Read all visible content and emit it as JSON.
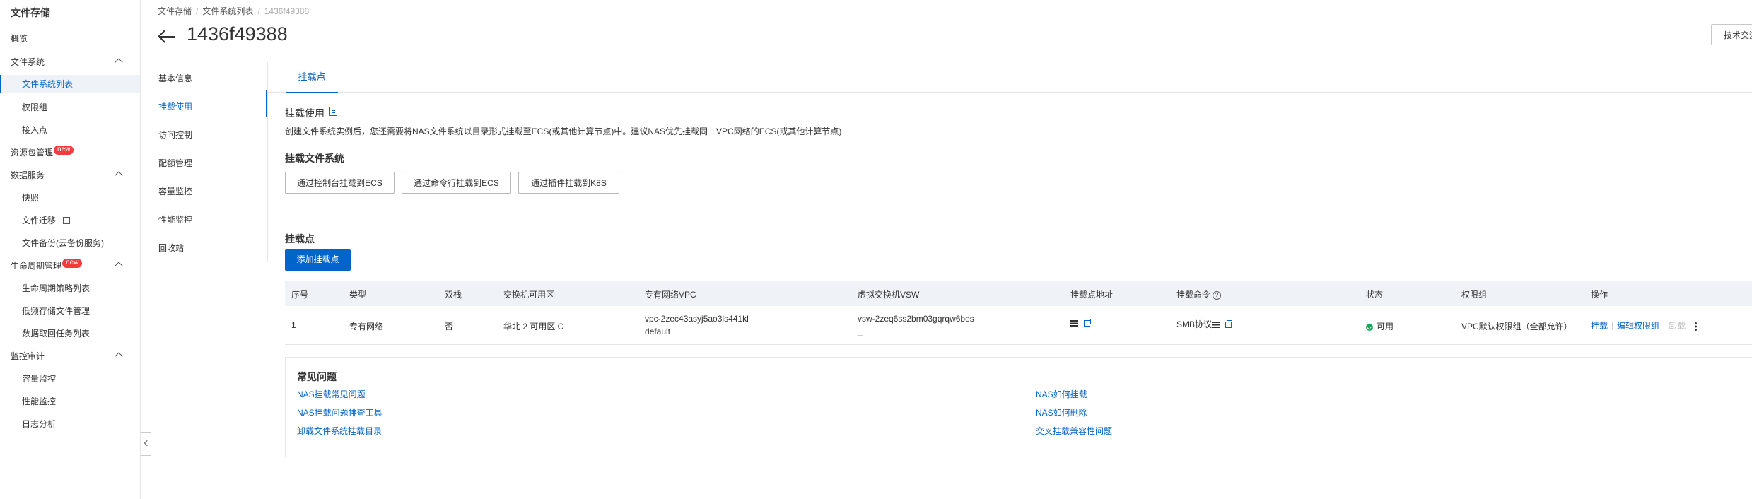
{
  "sidebar": {
    "title": "文件存储",
    "items": [
      {
        "label": "概览"
      },
      {
        "label": "文件系统"
      },
      {
        "label": "文件系统列表"
      },
      {
        "label": "权限组"
      },
      {
        "label": "接入点"
      },
      {
        "label": "资源包管理",
        "badge": "new"
      },
      {
        "label": "数据服务"
      },
      {
        "label": "快照"
      },
      {
        "label": "文件迁移"
      },
      {
        "label": "文件备份(云备份服务)"
      },
      {
        "label": "生命周期管理",
        "badge": "new"
      },
      {
        "label": "生命周期策略列表"
      },
      {
        "label": "低频存储文件管理"
      },
      {
        "label": "数据取回任务列表"
      },
      {
        "label": "监控审计"
      },
      {
        "label": "容量监控"
      },
      {
        "label": "性能监控"
      },
      {
        "label": "日志分析"
      }
    ]
  },
  "breadcrumb": [
    "文件存储",
    "文件系统列表",
    "1436f49388"
  ],
  "header": {
    "title": "1436f49388",
    "support_button": "技术交流群"
  },
  "detail_nav": [
    "基本信息",
    "挂载使用",
    "访问控制",
    "配额管理",
    "容量监控",
    "性能监控",
    "回收站"
  ],
  "tab": {
    "label": "挂载点"
  },
  "usage": {
    "section_label": "挂载使用",
    "description": "创建文件系统实例后，您还需要将NAS文件系统以目录形式挂载至ECS(或其他计算节点)中。建议NAS优先挂载同一VPC网络的ECS(或其他计算节点)",
    "mount_heading": "挂载文件系统",
    "buttons": [
      "通过控制台挂载到ECS",
      "通过命令行挂载到ECS",
      "通过插件挂载到K8S"
    ]
  },
  "mount_points": {
    "heading": "挂载点",
    "add_button": "添加挂载点",
    "columns": [
      "序号",
      "类型",
      "双栈",
      "交换机可用区",
      "专有网络VPC",
      "虚拟交换机VSW",
      "挂载点地址",
      "挂载命令",
      "状态",
      "权限组",
      "操作"
    ],
    "rows": [
      {
        "index": "1",
        "type": "专有网络",
        "dual_stack": "否",
        "zone": "华北 2 可用区 C",
        "vpc_id": "vpc-2zec43asyj5ao3ls441kl",
        "vpc_name": "default",
        "vsw_id": "vsw-2zeq6ss2bm03gqrqw6bes",
        "vsw_name": "_",
        "mount_command": "SMB协议",
        "status": "可用",
        "permission_group": "VPC默认权限组（全部允许）",
        "actions": [
          "挂载",
          "编辑权限组",
          "卸载"
        ]
      }
    ]
  },
  "faq": {
    "title": "常见问题",
    "links": [
      "NAS挂载常见问题",
      "NAS挂载问题排查工具",
      "卸载文件系统挂载目录",
      "NAS如何挂载",
      "NAS如何删除",
      "交叉挂载兼容性问题"
    ]
  },
  "icons": [
    "chevron-up-icon",
    "external-link-icon",
    "back-arrow-icon",
    "clipboard-icon",
    "help-icon",
    "list-icon",
    "copy-icon",
    "check-circle-icon",
    "more-vertical-icon",
    "chevron-left-icon"
  ],
  "colors": {
    "accent": "#0064c8",
    "success": "#1aa659",
    "badge": "#f23c3c"
  }
}
